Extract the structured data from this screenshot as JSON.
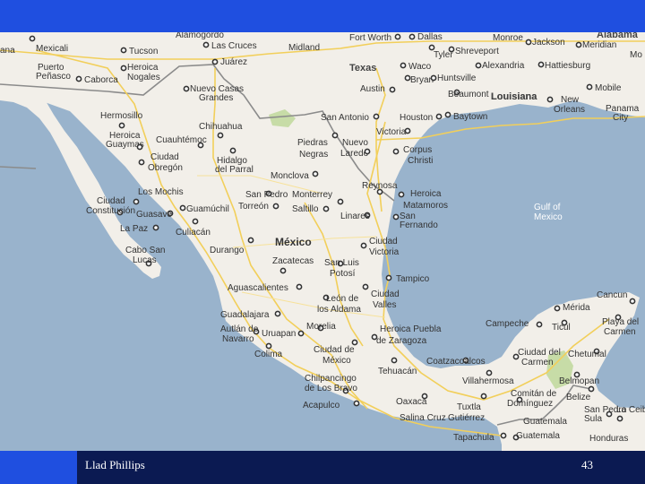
{
  "slide": {
    "author": "Llad Phillips",
    "page_number": "43"
  },
  "colors": {
    "header_bar": "#1f4fe0",
    "footer_bar": "#0b1a52",
    "water": "#99b3cc",
    "land": "#f2efe9",
    "park": "#c7dca7"
  },
  "map": {
    "states": {
      "texas": "Texas",
      "louisiana": "Louisiana"
    },
    "country": "México",
    "waters": {
      "gulf": [
        "Gulf of",
        "Mexico"
      ]
    },
    "cities": {
      "ana": "ana",
      "mexicali": "Mexicali",
      "tucson": "Tucson",
      "alamogordo": "Alamogordo",
      "las_cruces": "Las Cruces",
      "juarez": "Juárez",
      "midland": "Midland",
      "fort_worth": "Fort Worth",
      "dallas": "Dallas",
      "monroe": "Monroe",
      "jackson": "Jackson",
      "meridian": "Meridian",
      "alabama": "Alabama",
      "tyler": "Tyler",
      "shreveport": "Shreveport",
      "waco": "Waco",
      "alexandria": "Alexandria",
      "hattiesburg": "Hattiesburg",
      "mo": "Mo",
      "puerto_penasco": [
        "Puerto",
        "Peñasco"
      ],
      "heroica_nogales": [
        "Heroica",
        "Nogales"
      ],
      "caborca": "Caborca",
      "nuevo_casas_grandes": [
        "Nuevo Casas",
        "Grandes"
      ],
      "austin": "Austin",
      "bryan": "Bryan",
      "huntsville": "Huntsville",
      "louisiana_city": "Louisiana",
      "beaumont": "Beaumont",
      "new_orleans": [
        "New",
        "Orleans"
      ],
      "mobile": "Mobile",
      "panama_city": [
        "Panama",
        "City"
      ],
      "baytown": "Baytown",
      "hermosillo": "Hermosillo",
      "chihuahua": "Chihuahua",
      "san_antonio": "San Antonio",
      "houston": "Houston",
      "heroica_guaymas": [
        "Heroica",
        "Guaymas"
      ],
      "cuauhtemoc": "Cuauhtémoc",
      "piedras_negras": [
        "Piedras",
        "Negras"
      ],
      "nuevo_laredo": [
        "Nuevo",
        "Laredo"
      ],
      "victoria": "Victoria",
      "corpus_christi": [
        "Corpus",
        "Christi"
      ],
      "ciudad_obregon": [
        "Ciudad",
        "Obregón"
      ],
      "hidalgo_del_parral": [
        "Hidalgo",
        "del Parral"
      ],
      "monclova": "Monclova",
      "los_mochis": "Los Mochis",
      "san_pedro": "San Pedro",
      "monterrey": "Monterrey",
      "reynosa": "Reynosa",
      "heroica_matamoros": [
        "Heroica",
        "Matamoros"
      ],
      "ciudad_constitucion": [
        "Ciudad",
        "Constitución"
      ],
      "guamuchil": "Guamúchil",
      "torreon": "Torreón",
      "saltillo": "Saltillo",
      "guasave": "Guasave",
      "linares": "Linares",
      "san_fernando": [
        "San",
        "Fernando"
      ],
      "la_paz": "La Paz",
      "culiacan": "Culiacán",
      "durango": "Durango",
      "ciudad_victoria": [
        "Ciudad",
        "Victoria"
      ],
      "cabo_san_lucas": [
        "Cabo San",
        "Lucas"
      ],
      "zacatecas": "Zacatecas",
      "san_luis_potosi": [
        "San Luis",
        "Potosí"
      ],
      "tampico": "Tampico",
      "aguascalientes": "Aguascalientes",
      "leon_de_los_aldama": [
        "León de",
        "los Aldama"
      ],
      "ciudad_valles": [
        "Ciudad",
        "Valles"
      ],
      "cancun": "Cancun",
      "merida": "Mérida",
      "guadalajara": "Guadalajara",
      "campeche": "Campeche",
      "tizimin": "Ticul",
      "playa_del_carmen": [
        "Playa del",
        "Carmen"
      ],
      "autlan_de_navarro": [
        "Autlán de",
        "Navarro"
      ],
      "uruapan": "Uruapan",
      "morelia": "Morelia",
      "heroica_puebla": [
        "Heroica Puebla",
        "de Zaragoza"
      ],
      "colima": "Colima",
      "ciudad_de_mexico": [
        "Ciudad de",
        "México"
      ],
      "coatzacoalcos": "Coatzacoalcos",
      "ciudad_del_carmen": [
        "Ciudad del",
        "Carmen"
      ],
      "chetumal": "Chetumal",
      "tehuacan": "Tehuacán",
      "villahermosa": "Villahermosa",
      "belmopan": "Belmopan",
      "chilpancingo": [
        "Chilpancingo",
        "de Los Bravo"
      ],
      "comitan": [
        "Comitán de",
        "Domínguez"
      ],
      "belize": "Belize",
      "acapulco": "Acapulco",
      "oaxaca": "Oaxaca",
      "tuxtla_gutierrez": [
        "Tuxtla",
        "Gutiérrez"
      ],
      "san_pedro_sula": [
        "San Pedro",
        "Sula"
      ],
      "la_ceiba": "La Ceiba",
      "salina_cruz": "Salina Cruz",
      "guatemala_country": "Guatemala",
      "tapachula": "Tapachula",
      "guatemala_city": "Guatemala",
      "honduras": "Honduras"
    }
  }
}
